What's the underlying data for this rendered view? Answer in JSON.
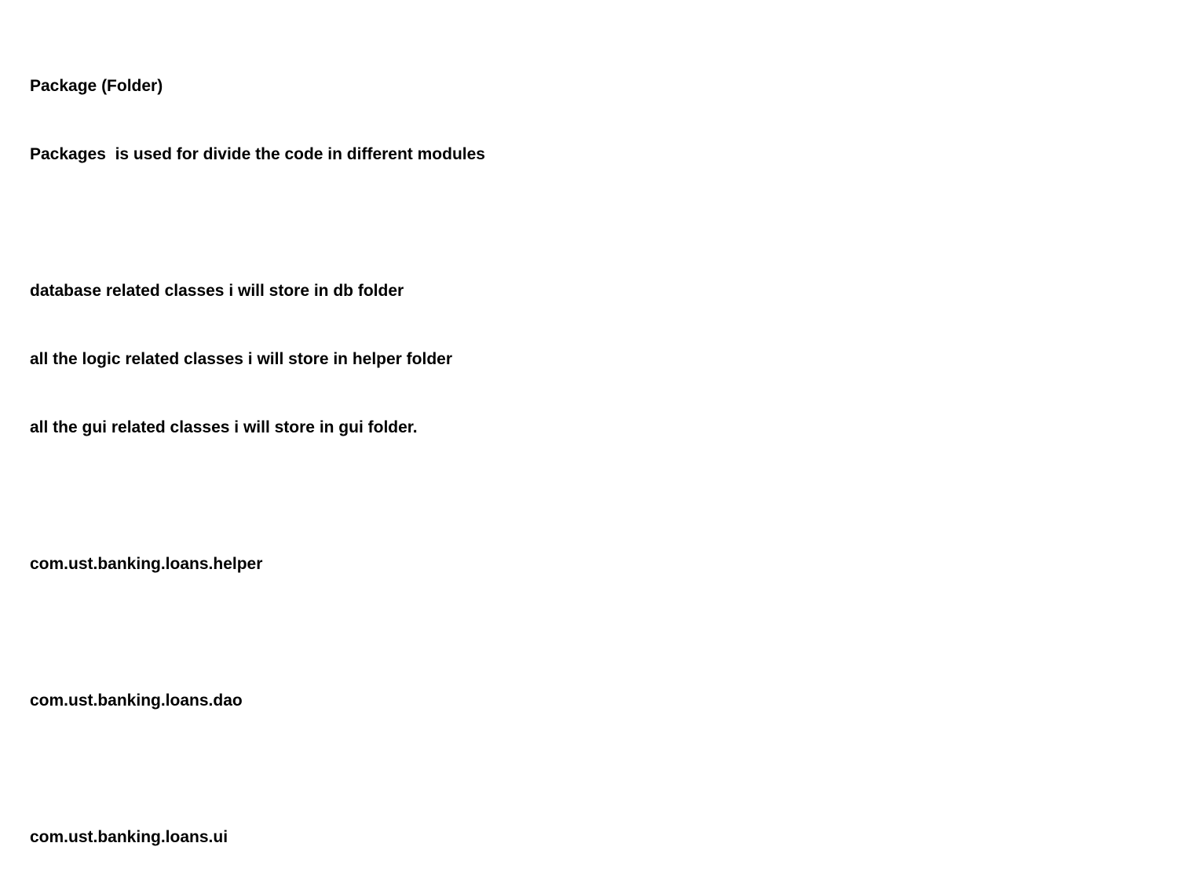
{
  "document": {
    "heading": "Package (Folder)",
    "description": "Packages  is used for divide the code in different modules",
    "notes": [
      "database related classes i will store in db folder",
      "all the logic related classes i will store in helper folder",
      "all the gui related classes i will store in gui folder."
    ],
    "packages": [
      "com.ust.banking.loans.helper",
      "com.ust.banking.loans.dao",
      "com.ust.banking.loans.ui"
    ]
  }
}
